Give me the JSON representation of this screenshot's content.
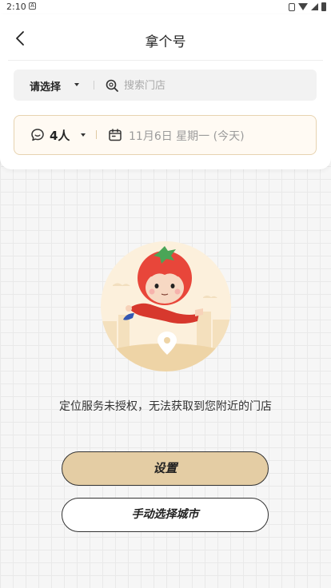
{
  "status_bar": {
    "time": "2:10",
    "notification_glyph": "A"
  },
  "nav": {
    "title": "拿个号",
    "back_icon": "chevron-left-icon"
  },
  "search": {
    "city_label": "请选择",
    "placeholder": "搜索门店",
    "search_icon": "search-icon"
  },
  "party": {
    "people_label": "4人",
    "date_label": "11月6日 星期一 (今天)",
    "people_icon": "chat-bubble-icon",
    "calendar_icon": "calendar-icon"
  },
  "empty_state": {
    "message": "定位服务未授权，无法获取到您附近的门店",
    "illustration": "flying-tomato-kid-location-pin"
  },
  "actions": {
    "settings_label": "设置",
    "manual_city_label": "手动选择城市"
  },
  "colors": {
    "accent_beige": "#e4cda4",
    "accent_border": "#e7d3b0",
    "tomato_red": "#e8463a",
    "background": "#f6f6f6"
  }
}
